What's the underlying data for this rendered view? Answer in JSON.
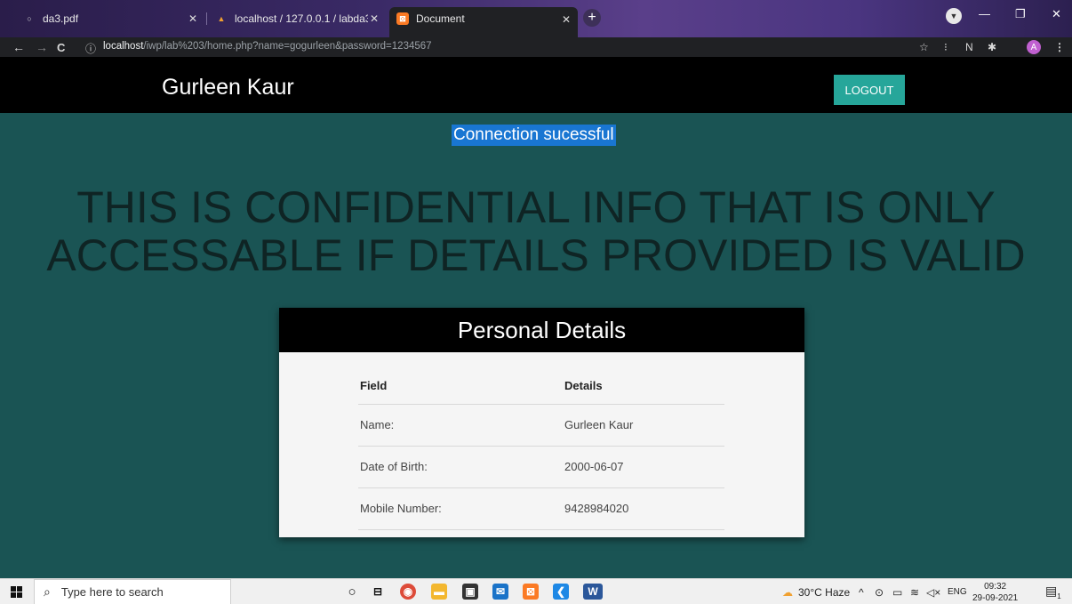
{
  "browser": {
    "tabs": [
      {
        "label": "da3.pdf",
        "icon": "globe-icon",
        "active": false
      },
      {
        "label": "localhost / 127.0.0.1 / labda3 / re",
        "icon": "phpmyadmin-icon",
        "active": false
      },
      {
        "label": "Document",
        "icon": "xampp-icon",
        "active": true
      }
    ],
    "url_scheme_icon": "info-icon",
    "url_host": "localhost",
    "url_path": "/iwp/lab%203/home.php?name=gogurleen&password=1234567",
    "avatar_letter": "A"
  },
  "navbar": {
    "brand": "Gurleen Kaur",
    "logout_label": "LOGOUT"
  },
  "status_message": "Connection sucessful",
  "headline_line1": "THIS IS CONFIDENTIAL INFO THAT IS ONLY",
  "headline_line2": "ACCESSABLE IF DETAILS PROVIDED IS VALID",
  "card": {
    "title": "Personal Details",
    "columns": [
      "Field",
      "Details"
    ],
    "rows": [
      [
        "Name:",
        "Gurleen Kaur"
      ],
      [
        "Date of Birth:",
        "2000-06-07"
      ],
      [
        "Mobile Number:",
        "9428984020"
      ]
    ]
  },
  "taskbar": {
    "search_placeholder": "Type here to search",
    "weather": "30°C  Haze",
    "lang": "ENG",
    "time": "09:32",
    "date": "29-09-2021",
    "notification_count": "1"
  },
  "colors": {
    "page_bg": "#1a5454",
    "navbar_bg": "#000000",
    "logout_bg": "#26a69a",
    "status_highlight": "#1976d2"
  }
}
